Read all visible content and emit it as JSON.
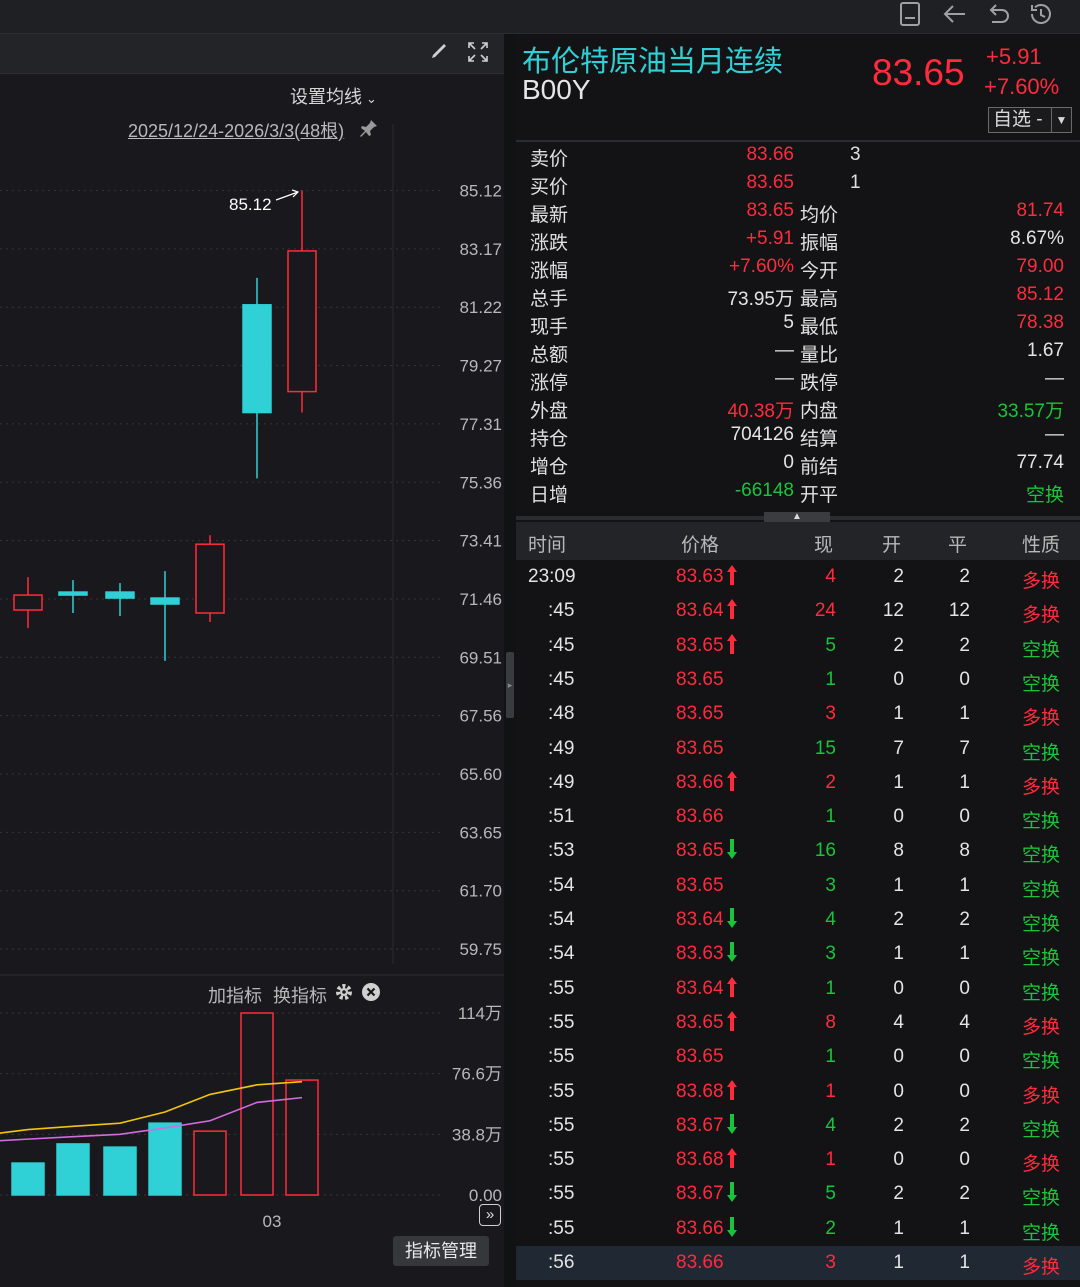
{
  "window_icons": [
    "bookmark-icon",
    "back-arrow-icon",
    "undo-icon",
    "history-icon"
  ],
  "chart": {
    "ma_setting": "设置均线",
    "range_label": "2025/12/24-2026/3/3(48根)",
    "high_marker": "85.12",
    "price_ticks": [
      "85.12",
      "83.17",
      "81.22",
      "79.27",
      "77.31",
      "75.36",
      "73.41",
      "71.46",
      "69.51",
      "67.56",
      "65.60",
      "63.65",
      "61.70",
      "59.75"
    ],
    "indicator_add": "加指标",
    "indicator_switch": "换指标",
    "volume_ticks": [
      "114万",
      "76.6万",
      "38.8万",
      "0.00"
    ],
    "x_label": "03",
    "indicator_manage": "指标管理",
    "colors": {
      "up": "#ff2b3d",
      "down": "#2fd0d6",
      "ma_yellow": "#f2c40f",
      "ma_pink": "#d36be0"
    }
  },
  "chart_data": {
    "type": "candlestick",
    "candles": [
      {
        "open": 71.6,
        "close": 71.1,
        "high": 72.2,
        "low": 70.5,
        "dir": "up"
      },
      {
        "open": 71.7,
        "close": 71.6,
        "high": 72.1,
        "low": 71.0,
        "dir": "down"
      },
      {
        "open": 71.7,
        "close": 71.5,
        "high": 72.0,
        "low": 70.9,
        "dir": "down"
      },
      {
        "open": 71.5,
        "close": 71.3,
        "high": 72.4,
        "low": 69.4,
        "dir": "down"
      },
      {
        "open": 71.0,
        "close": 73.3,
        "high": 73.6,
        "low": 70.7,
        "dir": "up"
      },
      {
        "open": 81.3,
        "close": 77.7,
        "high": 82.2,
        "low": 75.5,
        "dir": "down"
      },
      {
        "open": 78.4,
        "close": 83.1,
        "high": 85.12,
        "low": 77.7,
        "dir": "up"
      }
    ],
    "volume": [
      {
        "v": 20,
        "dir": "down"
      },
      {
        "v": 32,
        "dir": "down"
      },
      {
        "v": 30,
        "dir": "down"
      },
      {
        "v": 45,
        "dir": "down"
      },
      {
        "v": 40,
        "dir": "up"
      },
      {
        "v": 114,
        "dir": "up"
      },
      {
        "v": 72,
        "dir": "up"
      }
    ],
    "ma_yellow": [
      38.8,
      41,
      43,
      45,
      52,
      63,
      69,
      71
    ],
    "ma_pink": [
      34,
      35,
      36.5,
      38,
      42,
      46.5,
      58,
      61
    ]
  },
  "quote": {
    "name": "布伦特原油当月连续",
    "code": "B00Y",
    "price": "83.65",
    "change": "+5.91",
    "change_pct": "+7.60%",
    "favorite": "自选 -"
  },
  "quote_rows": [
    {
      "l1": "卖价",
      "v1": "83.66",
      "c1": "red",
      "extra": "3"
    },
    {
      "l1": "买价",
      "v1": "83.65",
      "c1": "red",
      "extra": "1"
    },
    {
      "l1": "最新",
      "v1": "83.65",
      "c1": "red",
      "l2": "均价",
      "v2": "81.74",
      "c2": "red"
    },
    {
      "l1": "涨跌",
      "v1": "+5.91",
      "c1": "red",
      "l2": "振幅",
      "v2": "8.67%",
      "c2": "white"
    },
    {
      "l1": "涨幅",
      "v1": "+7.60%",
      "c1": "red",
      "l2": "今开",
      "v2": "79.00",
      "c2": "red"
    },
    {
      "l1": "总手",
      "v1": "73.95万",
      "c1": "white",
      "l2": "最高",
      "v2": "85.12",
      "c2": "red"
    },
    {
      "l1": "现手",
      "v1": "5",
      "c1": "white",
      "l2": "最低",
      "v2": "78.38",
      "c2": "red"
    },
    {
      "l1": "总额",
      "v1": "—",
      "c1": "white",
      "l2": "量比",
      "v2": "1.67",
      "c2": "white"
    },
    {
      "l1": "涨停",
      "v1": "—",
      "c1": "white",
      "l2": "跌停",
      "v2": "—",
      "c2": "white"
    },
    {
      "l1": "外盘",
      "v1": "40.38万",
      "c1": "red",
      "l2": "内盘",
      "v2": "33.57万",
      "c2": "green"
    },
    {
      "l1": "持仓",
      "v1": "704126",
      "c1": "white",
      "l2": "结算",
      "v2": "—",
      "c2": "white"
    },
    {
      "l1": "增仓",
      "v1": "0",
      "c1": "white",
      "l2": "前结",
      "v2": "77.74",
      "c2": "white"
    },
    {
      "l1": "日增",
      "v1": "-66148",
      "c1": "green",
      "l2": "开平",
      "v2": "空换",
      "c2": "green"
    }
  ],
  "tick_headers": [
    "时间",
    "价格",
    "现",
    "开",
    "平",
    "性质"
  ],
  "ticks": [
    {
      "t": "23:09",
      "p": "83.63",
      "arrow": "up",
      "n": "4",
      "nc": "red",
      "o": "2",
      "c": "2",
      "k": "多换",
      "kc": "red"
    },
    {
      "t": ":45",
      "p": "83.64",
      "arrow": "up",
      "n": "24",
      "nc": "red",
      "o": "12",
      "c": "12",
      "k": "多换",
      "kc": "red"
    },
    {
      "t": ":45",
      "p": "83.65",
      "arrow": "up",
      "n": "5",
      "nc": "green",
      "o": "2",
      "c": "2",
      "k": "空换",
      "kc": "green"
    },
    {
      "t": ":45",
      "p": "83.65",
      "arrow": "",
      "n": "1",
      "nc": "green",
      "o": "0",
      "c": "0",
      "k": "空换",
      "kc": "green"
    },
    {
      "t": ":48",
      "p": "83.65",
      "arrow": "",
      "n": "3",
      "nc": "red",
      "o": "1",
      "c": "1",
      "k": "多换",
      "kc": "red"
    },
    {
      "t": ":49",
      "p": "83.65",
      "arrow": "",
      "n": "15",
      "nc": "green",
      "o": "7",
      "c": "7",
      "k": "空换",
      "kc": "green"
    },
    {
      "t": ":49",
      "p": "83.66",
      "arrow": "up",
      "n": "2",
      "nc": "red",
      "o": "1",
      "c": "1",
      "k": "多换",
      "kc": "red"
    },
    {
      "t": ":51",
      "p": "83.66",
      "arrow": "",
      "n": "1",
      "nc": "green",
      "o": "0",
      "c": "0",
      "k": "空换",
      "kc": "green"
    },
    {
      "t": ":53",
      "p": "83.65",
      "arrow": "down",
      "n": "16",
      "nc": "green",
      "o": "8",
      "c": "8",
      "k": "空换",
      "kc": "green"
    },
    {
      "t": ":54",
      "p": "83.65",
      "arrow": "",
      "n": "3",
      "nc": "green",
      "o": "1",
      "c": "1",
      "k": "空换",
      "kc": "green"
    },
    {
      "t": ":54",
      "p": "83.64",
      "arrow": "down",
      "n": "4",
      "nc": "green",
      "o": "2",
      "c": "2",
      "k": "空换",
      "kc": "green"
    },
    {
      "t": ":54",
      "p": "83.63",
      "arrow": "down",
      "n": "3",
      "nc": "green",
      "o": "1",
      "c": "1",
      "k": "空换",
      "kc": "green"
    },
    {
      "t": ":55",
      "p": "83.64",
      "arrow": "up",
      "n": "1",
      "nc": "green",
      "o": "0",
      "c": "0",
      "k": "空换",
      "kc": "green"
    },
    {
      "t": ":55",
      "p": "83.65",
      "arrow": "up",
      "n": "8",
      "nc": "red",
      "o": "4",
      "c": "4",
      "k": "多换",
      "kc": "red"
    },
    {
      "t": ":55",
      "p": "83.65",
      "arrow": "",
      "n": "1",
      "nc": "green",
      "o": "0",
      "c": "0",
      "k": "空换",
      "kc": "green"
    },
    {
      "t": ":55",
      "p": "83.68",
      "arrow": "up",
      "n": "1",
      "nc": "red",
      "o": "0",
      "c": "0",
      "k": "多换",
      "kc": "red"
    },
    {
      "t": ":55",
      "p": "83.67",
      "arrow": "down",
      "n": "4",
      "nc": "green",
      "o": "2",
      "c": "2",
      "k": "空换",
      "kc": "green"
    },
    {
      "t": ":55",
      "p": "83.68",
      "arrow": "up",
      "n": "1",
      "nc": "red",
      "o": "0",
      "c": "0",
      "k": "多换",
      "kc": "red"
    },
    {
      "t": ":55",
      "p": "83.67",
      "arrow": "down",
      "n": "5",
      "nc": "green",
      "o": "2",
      "c": "2",
      "k": "空换",
      "kc": "green"
    },
    {
      "t": ":55",
      "p": "83.66",
      "arrow": "down",
      "n": "2",
      "nc": "green",
      "o": "1",
      "c": "1",
      "k": "空换",
      "kc": "green"
    },
    {
      "t": ":56",
      "p": "83.66",
      "arrow": "",
      "n": "3",
      "nc": "red",
      "o": "1",
      "c": "1",
      "k": "多换",
      "kc": "red"
    }
  ]
}
